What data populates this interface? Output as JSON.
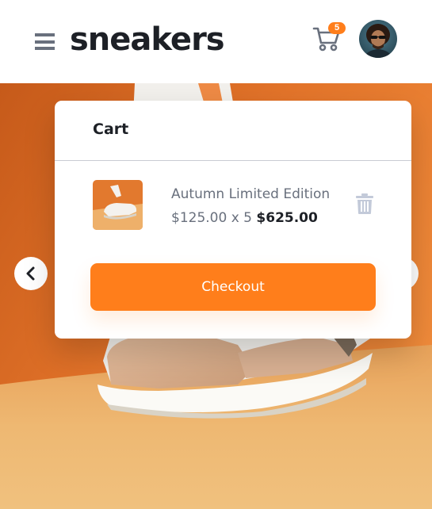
{
  "header": {
    "logo": "sneakers",
    "menu_icon": "hamburger-icon",
    "cart_icon": "cart-icon",
    "cart_count": "5",
    "avatar_icon": "user-avatar"
  },
  "hero": {
    "prev_icon": "chevron-left-icon",
    "next_icon": "chevron-right-icon"
  },
  "cart": {
    "title": "Cart",
    "items": [
      {
        "name": "Autumn Limited Edition",
        "unit_price": "$125.00",
        "quantity_text": "x 5",
        "total": "$625.00",
        "delete_icon": "trash-icon"
      }
    ],
    "checkout_label": "Checkout"
  },
  "colors": {
    "accent": "#ff7e1b",
    "dark": "#1d2026",
    "muted": "#69707d",
    "icon_muted": "#c3cad9"
  }
}
